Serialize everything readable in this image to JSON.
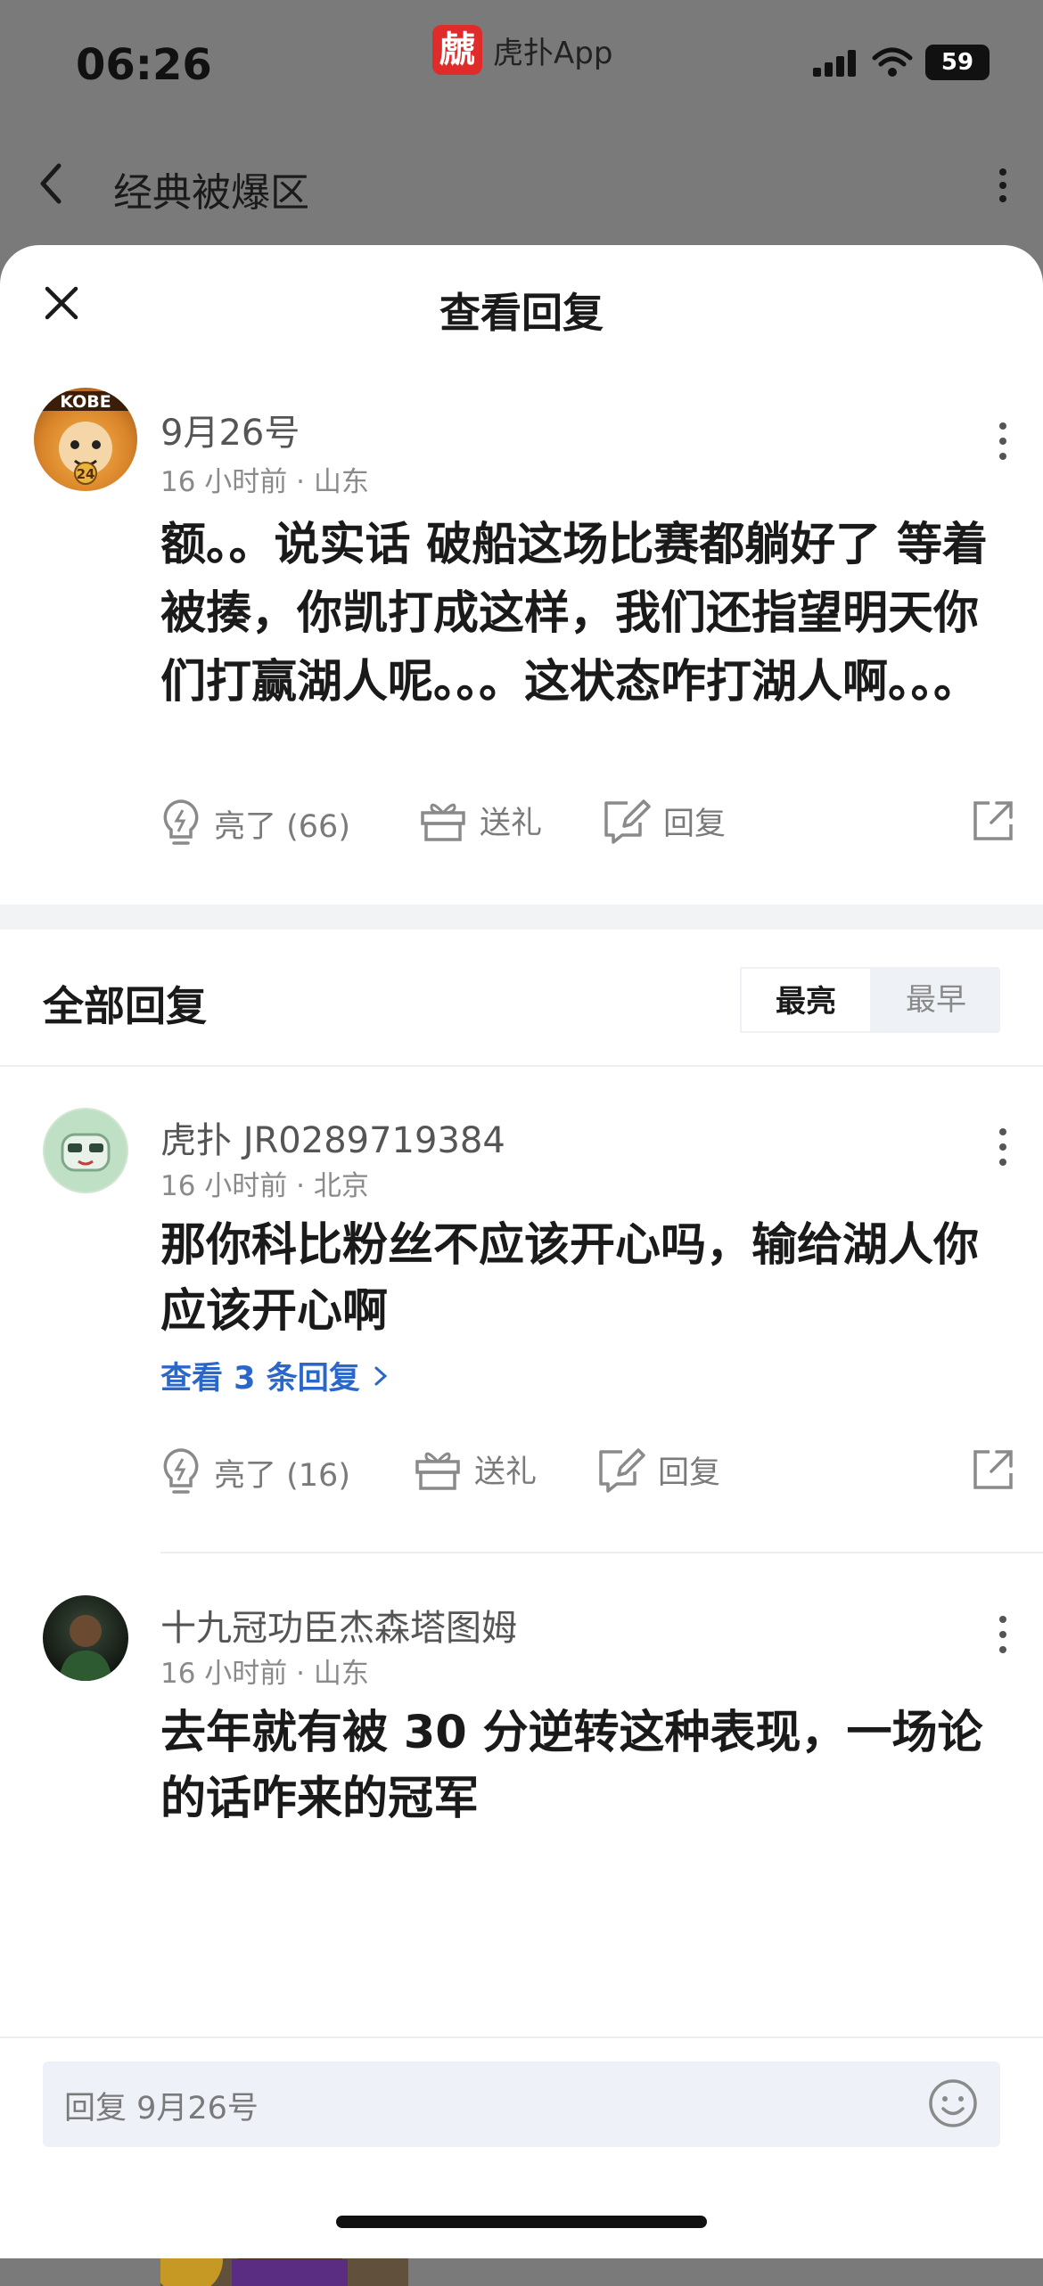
{
  "status_bar": {
    "time": "06:26",
    "app_name": "虎扑App",
    "app_logo_char": "虤",
    "battery": "59"
  },
  "nav": {
    "title": "经典被爆区"
  },
  "sheet": {
    "title": "查看回复"
  },
  "main_post": {
    "username": "9月26号",
    "meta": "16 小时前 · 山东",
    "avatar_text": "KOBE",
    "avatar_number": "24",
    "content": "额。。说实话 破船这场比赛都躺好了 等着被揍，你凯打成这样，我们还指望明天你们打赢湖人呢。。。这状态咋打湖人啊。。。",
    "actions": {
      "light": "亮了 (66)",
      "gift": "送礼",
      "reply": "回复"
    }
  },
  "replies_section": {
    "title": "全部回复",
    "sort_options": [
      "最亮",
      "最早"
    ],
    "active_sort": "最亮"
  },
  "replies": [
    {
      "username": "虎扑 JR0289719384",
      "meta": "16 小时前 · 北京",
      "content": "那你科比粉丝不应该开心吗，输给湖人你应该开心啊",
      "view_replies": "查看 3 条回复",
      "actions": {
        "light": "亮了 (16)",
        "gift": "送礼",
        "reply": "回复"
      }
    },
    {
      "username": "十九冠功臣杰森塔图姆",
      "meta": "16 小时前 · 山东",
      "content": "去年就有被 30 分逆转这种表现，一场论的话咋来的冠军"
    }
  ],
  "reply_bar": {
    "placeholder": "回复 9月26号"
  },
  "colors": {
    "accent_blue": "#2a67c9",
    "logo_red": "#e02b2b",
    "overlay_gray": "#7a7a7a"
  }
}
